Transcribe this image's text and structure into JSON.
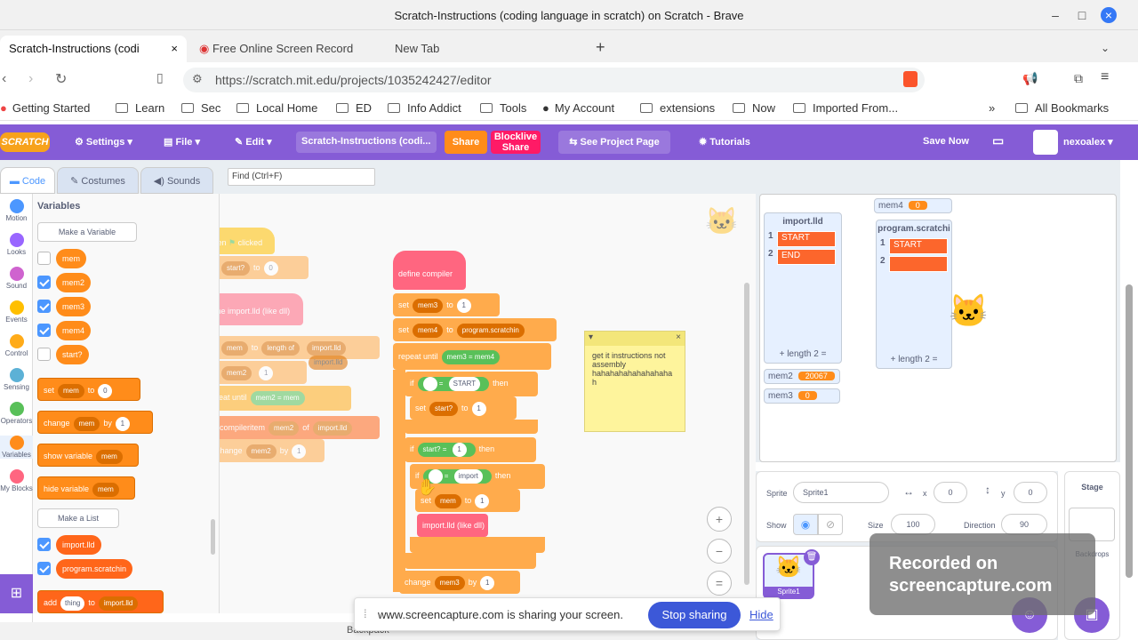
{
  "window": {
    "title": "Scratch-Instructions (coding language in scratch) on Scratch - Brave"
  },
  "tabs": [
    {
      "label": "Scratch-Instructions (codi"
    },
    {
      "label": "Free Online Screen Record"
    },
    {
      "label": "New Tab"
    }
  ],
  "address": {
    "url": "https://scratch.mit.edu/projects/1035242427/editor"
  },
  "bookmarks": [
    "Getting Started",
    "Learn",
    "Sec",
    "Local Home",
    "ED",
    "Info Addict",
    "Tools",
    "My Account",
    "extensions",
    "Now",
    "Imported From...",
    "All Bookmarks"
  ],
  "menu": {
    "logo": "SCRATCH",
    "settings": "Settings",
    "file": "File",
    "edit": "Edit",
    "project_title": "Scratch-Instructions (codi...",
    "share": "Share",
    "blocklive": "Blocklive Share",
    "see_project": "See Project Page",
    "tutorials": "Tutorials",
    "save_now": "Save Now",
    "user": "nexoalex"
  },
  "editor_tabs": {
    "code": "Code",
    "costumes": "Costumes",
    "sounds": "Sounds",
    "find_placeholder": "Find (Ctrl+F)"
  },
  "categories": [
    {
      "label": "Motion",
      "color": "#4c97ff"
    },
    {
      "label": "Looks",
      "color": "#9966ff"
    },
    {
      "label": "Sound",
      "color": "#cf63cf"
    },
    {
      "label": "Events",
      "color": "#ffbf00"
    },
    {
      "label": "Control",
      "color": "#ffab19"
    },
    {
      "label": "Sensing",
      "color": "#5cb1d6"
    },
    {
      "label": "Operators",
      "color": "#59c059"
    },
    {
      "label": "Variables",
      "color": "#ff8c1a"
    },
    {
      "label": "My Blocks",
      "color": "#ff6680"
    }
  ],
  "palette": {
    "heading": "Variables",
    "make_variable": "Make a Variable",
    "variables": [
      {
        "name": "mem",
        "checked": false
      },
      {
        "name": "mem2",
        "checked": true
      },
      {
        "name": "mem3",
        "checked": true
      },
      {
        "name": "mem4",
        "checked": true
      },
      {
        "name": "start?",
        "checked": false
      }
    ],
    "blocks": {
      "set": "set",
      "set_var": "mem",
      "set_to": "to",
      "set_val": "0",
      "change": "change",
      "change_var": "mem",
      "change_by": "by",
      "change_val": "1",
      "show": "show variable",
      "show_var": "mem",
      "hide": "hide variable",
      "hide_var": "mem"
    },
    "make_list": "Make a List",
    "lists": [
      {
        "name": "import.lld",
        "checked": true
      },
      {
        "name": "program.scratchin",
        "checked": true
      }
    ],
    "add": {
      "label": "add",
      "item": "thing",
      "to": "to",
      "list": "import.lld"
    }
  },
  "script": {
    "s1": {
      "when": "when",
      "clicked": "clicked",
      "set": "set",
      "var": "start?",
      "to": "to",
      "val": "0"
    },
    "s2": {
      "define": "define",
      "name": "import.lld (like dll)",
      "set": "set",
      "var": "mem",
      "to": "to",
      "length_of": "length of",
      "list": "import.lld",
      "list2": "import.lld",
      "set2": "set",
      "var2": "mem2",
      "val2": "1",
      "repeat": "repeat until",
      "a": "mem2",
      "eq": "=",
      "b": "mem",
      "compiler": "compiler",
      "item": "item",
      "item_var": "mem2",
      "of": "of",
      "item_list": "import.lld",
      "change": "change",
      "change_var": "mem2",
      "by": "by",
      "change_val": "1"
    },
    "s3": {
      "define": "define",
      "name": "compiler",
      "set1": "set",
      "var1": "mem3",
      "to1": "to",
      "val1": "1",
      "set2": "set",
      "var2": "mem4",
      "to2": "to",
      "val2": "program.scratchin",
      "repeat": "repeat until",
      "a": "mem3",
      "eq": "=",
      "b": "mem4",
      "if1": "if",
      "start_lit": "START",
      "then1": "then",
      "set3": "set",
      "var3": "start?",
      "to3": "to",
      "val3": "1",
      "if2": "if",
      "cond_var": "start?",
      "cond_val": "1",
      "then2": "then",
      "if3": "if",
      "import_lit": "import",
      "then3": "then",
      "set4": "set",
      "var4": "mem",
      "to4": "to",
      "val4": "1",
      "call": "import.lld (like dll)",
      "change": "change",
      "change_var": "mem3",
      "by": "by",
      "change_val": "1"
    },
    "note": "get it instructions not assembly hahahahahahahahaha h"
  },
  "stage": {
    "monitors": {
      "mem4": {
        "label": "mem4",
        "value": "0"
      },
      "mem2": {
        "label": "mem2",
        "value": "20067"
      },
      "mem3": {
        "label": "mem3",
        "value": "0"
      }
    },
    "list1": {
      "title": "import.lld",
      "items": [
        "START",
        "END"
      ],
      "length": "length 2"
    },
    "list2": {
      "title": "program.scratchi",
      "items": [
        "START",
        ""
      ],
      "length": "length 2"
    }
  },
  "sprite_info": {
    "sprite_label": "Sprite",
    "sprite_name": "Sprite1",
    "x_label": "x",
    "x": "0",
    "y_label": "y",
    "y": "0",
    "show_label": "Show",
    "size_label": "Size",
    "size": "100",
    "direction_label": "Direction",
    "direction": "90",
    "thumb_label": "Sprite1"
  },
  "stage_pane": {
    "title": "Stage",
    "backdrops": "Backdrops"
  },
  "recording": {
    "line1": "Recorded on",
    "line2": "screencapture.com"
  },
  "share_notice": {
    "text": "www.screencapture.com is sharing your screen.",
    "stop": "Stop sharing",
    "hide": "Hide"
  },
  "bottom_label": "Backpack"
}
